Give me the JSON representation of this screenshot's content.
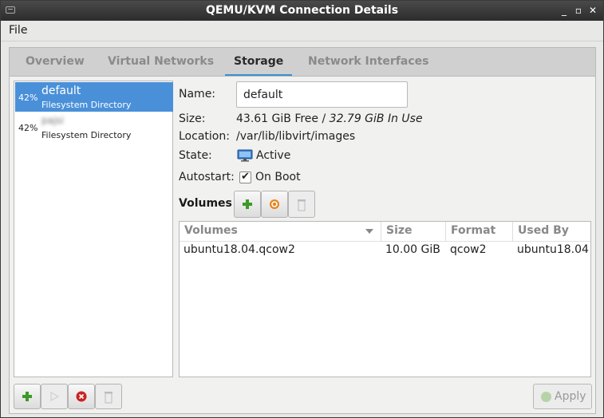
{
  "window": {
    "title": "QEMU/KVM Connection Details"
  },
  "menubar": {
    "file": "File"
  },
  "tabs": [
    {
      "label": "Overview"
    },
    {
      "label": "Virtual Networks"
    },
    {
      "label": "Storage",
      "active": true
    },
    {
      "label": "Network Interfaces"
    }
  ],
  "pools": [
    {
      "percent": "42%",
      "name": "default",
      "type": "Filesystem Directory",
      "selected": true
    },
    {
      "percent": "42%",
      "name": "pajsi",
      "type": "Filesystem Directory",
      "selected": false
    }
  ],
  "details": {
    "name_label": "Name:",
    "name_value": "default",
    "size_label": "Size:",
    "size_free": "43.61 GiB Free",
    "size_sep": " / ",
    "size_in_use": "32.79 GiB In Use",
    "location_label": "Location:",
    "location_value": "/var/lib/libvirt/images",
    "state_label": "State:",
    "state_value": "Active",
    "autostart_label": "Autostart:",
    "autostart_value": "On Boot",
    "autostart_checked": true
  },
  "volumes": {
    "heading": "Volumes",
    "columns": [
      "Volumes",
      "Size",
      "Format",
      "Used By"
    ],
    "rows": [
      {
        "name": "ubuntu18.04.qcow2",
        "size": "10.00 GiB",
        "format": "qcow2",
        "used_by": "ubuntu18.04"
      }
    ]
  },
  "footer": {
    "apply_label": "Apply"
  },
  "colors": {
    "accent": "#4a90d9",
    "tab_underline": "#3d8fd6",
    "add_green": "#3c9a2a",
    "delete_red": "#cc2222",
    "refresh_orange": "#e8841c"
  },
  "icons": [
    "add-icon",
    "play-icon",
    "stop-icon",
    "delete-icon",
    "refresh-icon",
    "monitor-icon",
    "apply-icon"
  ]
}
